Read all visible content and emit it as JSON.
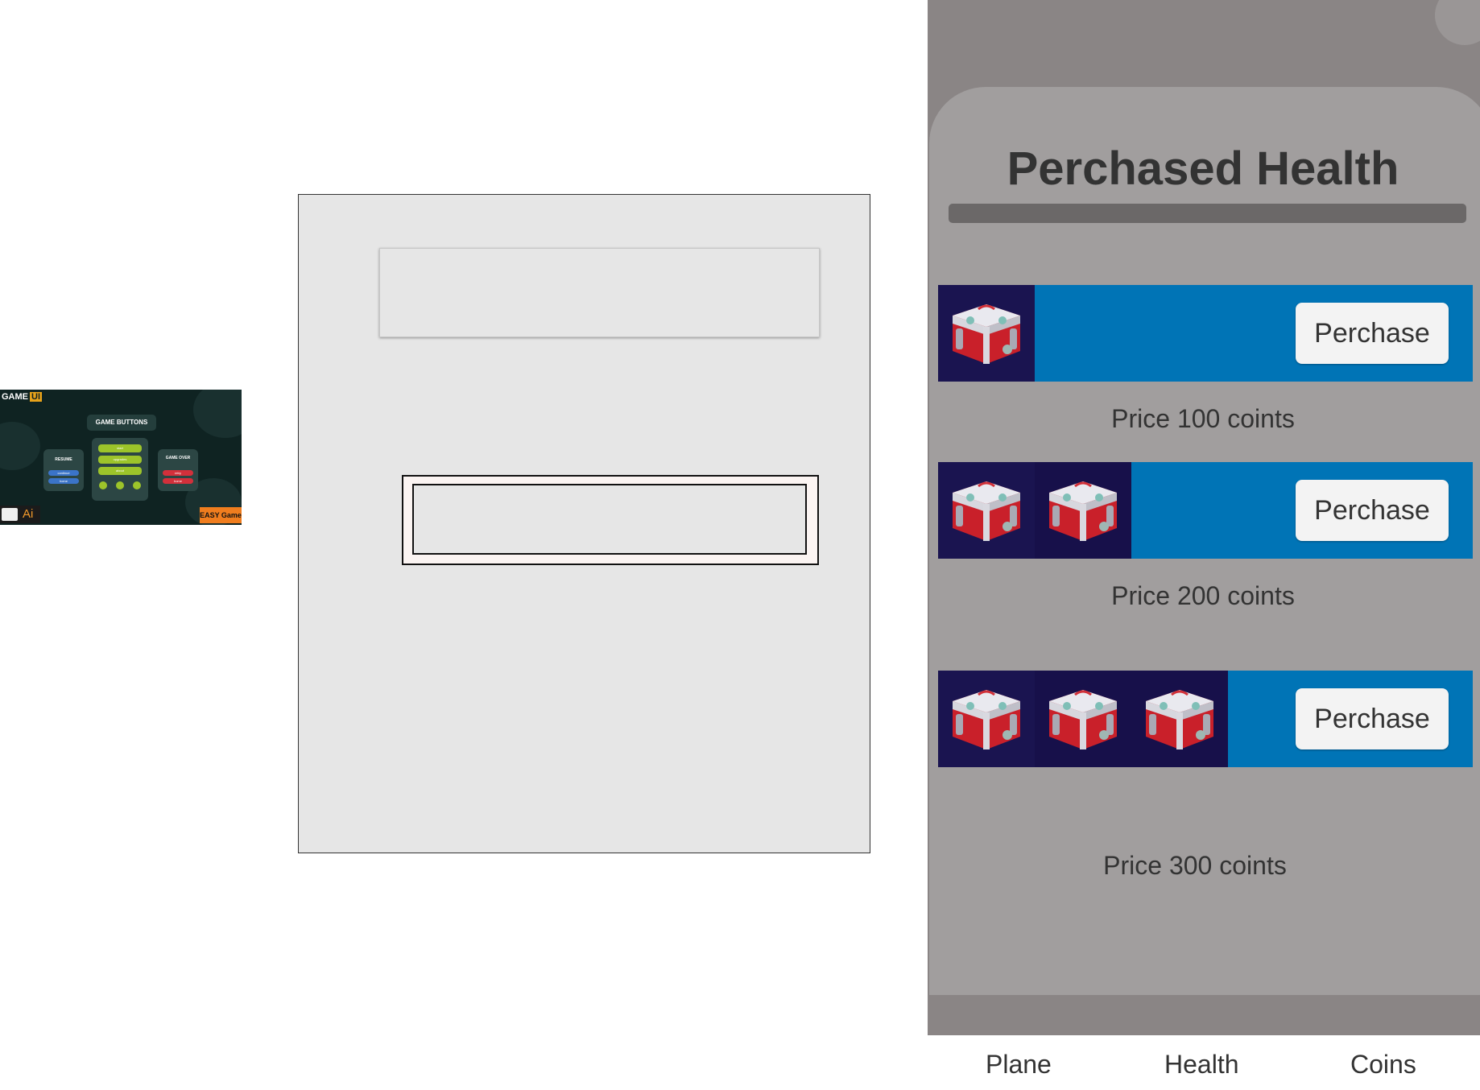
{
  "thumbnail": {
    "game_label": "GAME",
    "ui_label": "UI",
    "section_title": "GAME BUTTONS",
    "resume_card": {
      "title": "RESUME",
      "buttons": [
        "continue",
        "home"
      ]
    },
    "main_card": {
      "buttons": [
        "start",
        "upgrades",
        "about"
      ]
    },
    "gameover_card": {
      "title": "GAME OVER",
      "buttons": [
        "retry",
        "home"
      ]
    },
    "footer_left": "Ai",
    "footer_right": "EASY Game"
  },
  "mockup": {},
  "shop": {
    "title": "Perchased Health",
    "items": [
      {
        "icon_count": 1,
        "button_label": "Perchase",
        "price_text": "Price 100 coints"
      },
      {
        "icon_count": 2,
        "button_label": "Perchase",
        "price_text": "Price 200 coints"
      },
      {
        "icon_count": 3,
        "button_label": "Perchase",
        "price_text": "Price 300 coints"
      }
    ],
    "icon_name": "health-crate-icon",
    "colors": {
      "row_bg": "#0074b6",
      "icon_bg": "#1a1450",
      "panel_bg": "#a19e9e",
      "screen_bg": "#8a8585"
    }
  },
  "tabs": [
    {
      "label": "Plane"
    },
    {
      "label": "Health"
    },
    {
      "label": "Coins"
    }
  ]
}
